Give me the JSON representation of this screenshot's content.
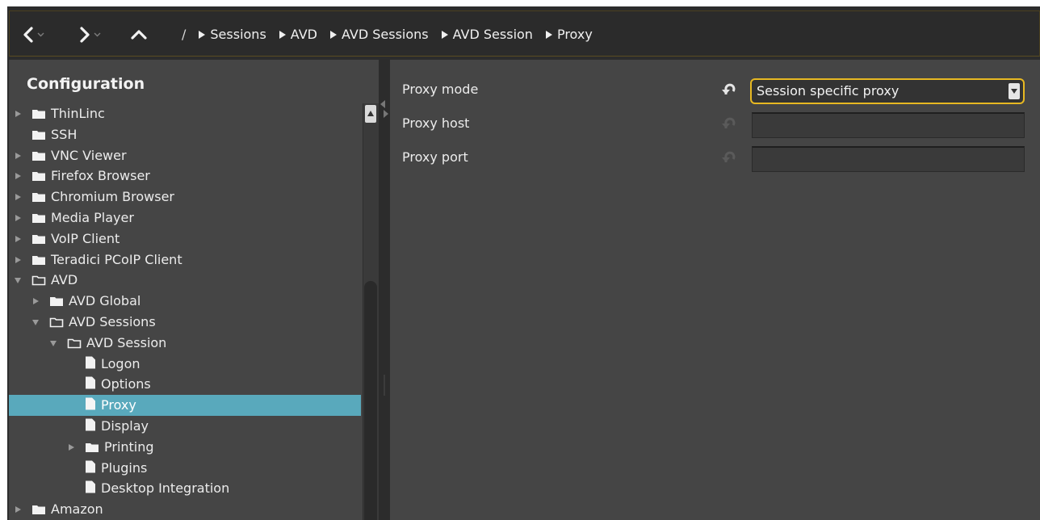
{
  "breadcrumb": {
    "root": "/",
    "items": [
      "Sessions",
      "AVD",
      "AVD Sessions",
      "AVD Session",
      "Proxy"
    ]
  },
  "left_panel": {
    "title": "Configuration",
    "tree": [
      {
        "label": "ThinLinc",
        "icon": "folder-filled-icon",
        "expander": "collapsed",
        "level": 0
      },
      {
        "label": "SSH",
        "icon": "folder-filled-icon",
        "expander": "none",
        "level": 0
      },
      {
        "label": "VNC Viewer",
        "icon": "folder-filled-icon",
        "expander": "collapsed",
        "level": 0
      },
      {
        "label": "Firefox Browser",
        "icon": "folder-filled-icon",
        "expander": "collapsed",
        "level": 0
      },
      {
        "label": "Chromium Browser",
        "icon": "folder-filled-icon",
        "expander": "collapsed",
        "level": 0
      },
      {
        "label": "Media Player",
        "icon": "folder-filled-icon",
        "expander": "collapsed",
        "level": 0
      },
      {
        "label": "VoIP Client",
        "icon": "folder-filled-icon",
        "expander": "collapsed",
        "level": 0
      },
      {
        "label": "Teradici PCoIP Client",
        "icon": "folder-filled-icon",
        "expander": "collapsed",
        "level": 0
      },
      {
        "label": "AVD",
        "icon": "folder-open-icon",
        "expander": "expanded",
        "level": 0
      },
      {
        "label": "AVD Global",
        "icon": "folder-filled-icon",
        "expander": "collapsed",
        "level": 1
      },
      {
        "label": "AVD Sessions",
        "icon": "folder-open-icon",
        "expander": "expanded",
        "level": 1
      },
      {
        "label": "AVD Session",
        "icon": "folder-open-icon",
        "expander": "expanded",
        "level": 2
      },
      {
        "label": "Logon",
        "icon": "file-icon",
        "expander": "none",
        "level": 3
      },
      {
        "label": "Options",
        "icon": "file-icon",
        "expander": "none",
        "level": 3
      },
      {
        "label": "Proxy",
        "icon": "file-icon",
        "expander": "none",
        "level": 3,
        "selected": true
      },
      {
        "label": "Display",
        "icon": "file-icon",
        "expander": "none",
        "level": 3
      },
      {
        "label": "Printing",
        "icon": "folder-filled-icon",
        "expander": "collapsed",
        "level": 3
      },
      {
        "label": "Plugins",
        "icon": "file-icon",
        "expander": "none",
        "level": 3
      },
      {
        "label": "Desktop Integration",
        "icon": "file-icon",
        "expander": "none",
        "level": 3
      },
      {
        "label": "Amazon",
        "icon": "folder-filled-icon",
        "expander": "collapsed",
        "level": 0
      }
    ]
  },
  "settings": {
    "proxy_mode": {
      "label": "Proxy mode",
      "value": "Session specific proxy"
    },
    "proxy_host": {
      "label": "Proxy host",
      "value": ""
    },
    "proxy_port": {
      "label": "Proxy port",
      "value": ""
    }
  },
  "colors": {
    "selection": "#59a9bc",
    "focus_border": "#e7b822",
    "panel_bg": "#454545"
  }
}
